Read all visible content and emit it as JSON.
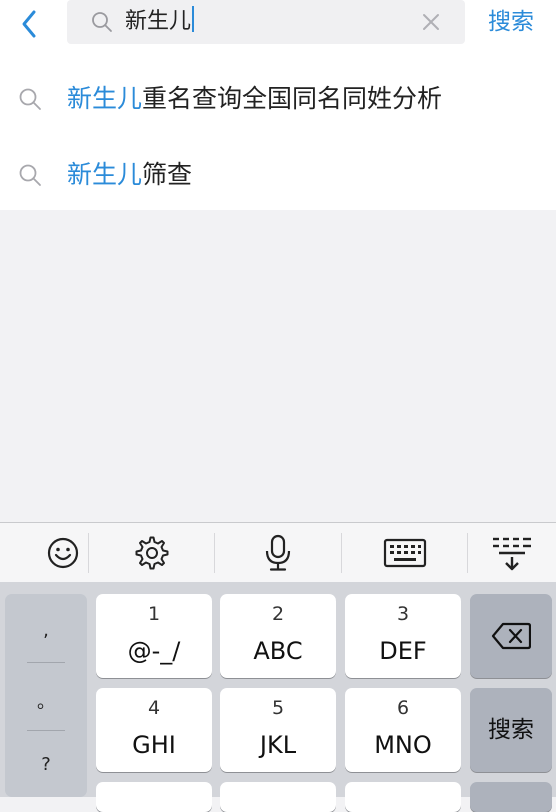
{
  "search_bar": {
    "query": "新生儿",
    "submit_label": "搜索",
    "back_icon": "chevron-left-icon",
    "search_icon": "search-icon",
    "clear_icon": "close-icon"
  },
  "suggestions": [
    {
      "keyword": "新生儿",
      "rest": "重名查询全国同名同姓分析"
    },
    {
      "keyword": "新生儿",
      "rest": "筛查"
    }
  ],
  "keyboard": {
    "toolbar": [
      "emoji-icon",
      "settings-icon",
      "microphone-icon",
      "keyboard-icon",
      "collapse-keyboard-icon"
    ],
    "punctuation": [
      ",",
      "。",
      "?"
    ],
    "keys": [
      {
        "num": "1",
        "letters": "@-_/"
      },
      {
        "num": "2",
        "letters": "ABC"
      },
      {
        "num": "3",
        "letters": "DEF"
      },
      {
        "num": "4",
        "letters": "GHI"
      },
      {
        "num": "5",
        "letters": "JKL"
      },
      {
        "num": "6",
        "letters": "MNO"
      }
    ],
    "delete_icon": "backspace-icon",
    "enter_label": "搜索"
  },
  "colors": {
    "accent": "#2b8bd9",
    "keyboard_bg": "#d3d5da"
  }
}
